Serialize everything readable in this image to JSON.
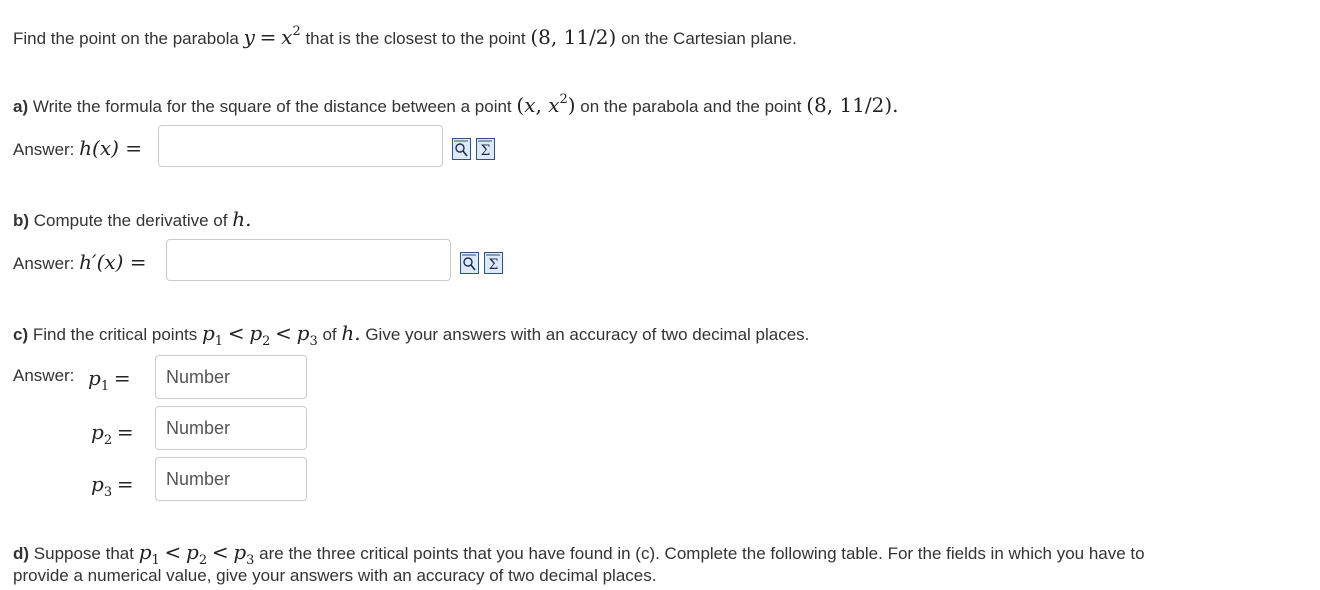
{
  "question": {
    "intro_prefix": "Find the point on the parabola ",
    "intro_middle": " that is the closest to the point ",
    "intro_point": "(8, 11/2)",
    "intro_suffix": " on the Cartesian plane."
  },
  "part_a": {
    "letter": "a)",
    "text_prefix": " Write the formula for the square of the distance between a point ",
    "text_middle": " on the parabola and the point ",
    "text_point": "(8, 11/2).",
    "answer_label": "Answer: ",
    "answer_math": "h(x) ="
  },
  "part_b": {
    "letter": "b)",
    "text": " Compute the derivative of ",
    "text_var": "h.",
    "answer_label": "Answer: ",
    "answer_math": "h′(x) ="
  },
  "part_c": {
    "letter": "c)",
    "text_prefix": " Find the critical points ",
    "text_suffix": " of ",
    "text_var": "h.",
    "text_tail": " Give your answers with an accuracy of two decimal places.",
    "answer_label": "Answer: ",
    "p1_label": "p",
    "p1_sub": "1",
    "p2_label": "p",
    "p2_sub": "2",
    "p3_label": "p",
    "p3_sub": "3",
    "placeholder": "Number"
  },
  "part_d": {
    "letter": "d)",
    "text_prefix": " Suppose that ",
    "text_line1_suffix": " are the three critical points that you have found in (c). Complete the following table. For the fields in which you have to",
    "text_line2": "provide a numerical value, give your answers with an accuracy of two decimal places."
  },
  "tools": {
    "preview_icon": "preview-magnifier-icon",
    "equation_icon": "equation-editor-sigma-icon"
  }
}
